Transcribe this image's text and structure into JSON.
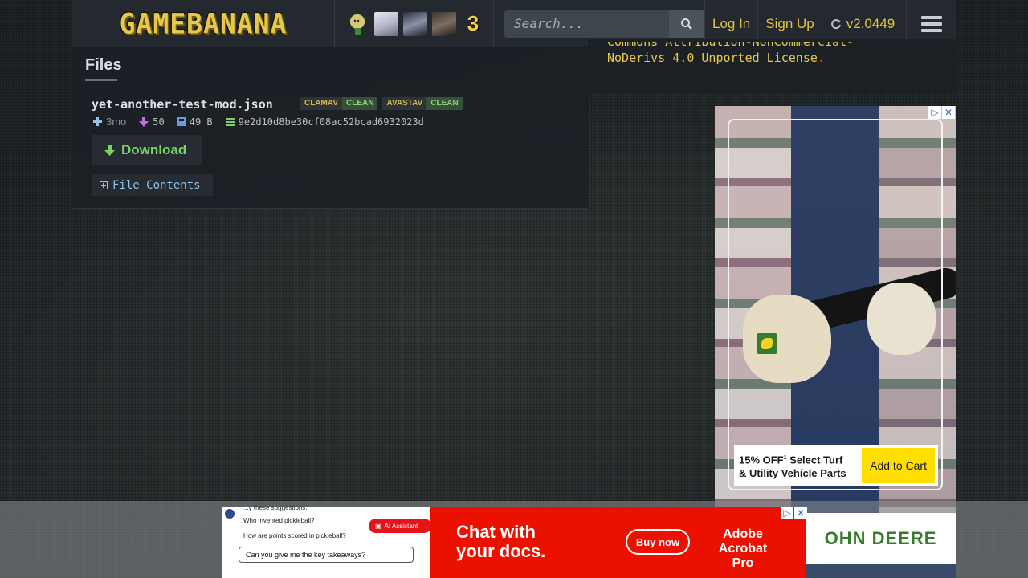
{
  "header": {
    "logo_text": "GAMEBANANA",
    "avatar_badge": "3",
    "search_placeholder": "Search...",
    "login_label": "Log In",
    "signup_label": "Sign Up",
    "version_label": "v2.0449"
  },
  "license": {
    "line1": "Commons Attribution-NonCommercial-",
    "line2": "NoDerivs 4.0 Unported License",
    "line2_end": "."
  },
  "files": {
    "title": "Files",
    "file_name": "yet-another-test-mod.json",
    "scans": [
      {
        "engine": "CLAMAV",
        "result": "CLEAN"
      },
      {
        "engine": "AVASTAV",
        "result": "CLEAN"
      }
    ],
    "age": "3mo",
    "downloads": "50",
    "size": "49 B",
    "checksum": "9e2d10d8be30cf08ac52bcad6932023d",
    "download_label": "Download",
    "contents_label": "File Contents"
  },
  "side_ad": {
    "offer_line1": "15% OFF",
    "offer_sup": "1",
    "offer_line1_rest": " Select Turf",
    "offer_line2": "& Utility Vehicle Parts",
    "cta_label": "Add to Cart",
    "brand_strip": "OHN DEERE"
  },
  "bottom_ad": {
    "q0": "...y these suggestions:",
    "q1": "Who invented pickleball?",
    "q2": "How are points scored in pickleball?",
    "ai_label": "AI Assistant",
    "ask": "Can you give me the key takeaways?",
    "headline1": "Chat with",
    "headline2": "your docs.",
    "buy_label": "Buy now",
    "brand1": "Adobe",
    "brand2": "Acrobat Pro"
  },
  "colors": {
    "accent_yellow": "#e2c34a",
    "download_green": "#7bd06a",
    "link_blue": "#8fc2e6",
    "adobe_red": "#eb1000",
    "deere_green": "#367c2b"
  }
}
